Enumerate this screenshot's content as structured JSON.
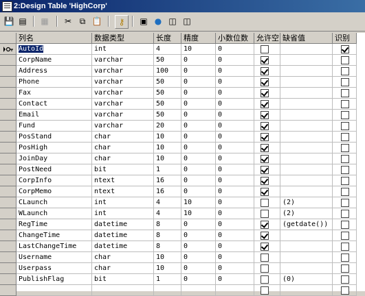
{
  "window": {
    "title": "2:Design Table 'HighCorp'"
  },
  "toolbar": {
    "icons": [
      "save-icon",
      "properties-icon",
      "generate-script-icon",
      "cut-icon",
      "copy-icon",
      "paste-icon",
      "primary-key-icon",
      "manage-indexes-icon",
      "manage-relationships-icon",
      "manage-constraints-icon",
      "manage-triggers-icon"
    ]
  },
  "columns": [
    "列名",
    "数据类型",
    "长度",
    "精度",
    "小数位数",
    "允许空",
    "缺省值",
    "识别"
  ],
  "rows": [
    {
      "name": "AutoId",
      "type": "int",
      "length": "4",
      "precision": "10",
      "scale": "0",
      "nullable": false,
      "default": "",
      "identity": true,
      "key": true
    },
    {
      "name": "CorpName",
      "type": "varchar",
      "length": "50",
      "precision": "0",
      "scale": "0",
      "nullable": true,
      "default": "",
      "identity": false
    },
    {
      "name": "Address",
      "type": "varchar",
      "length": "100",
      "precision": "0",
      "scale": "0",
      "nullable": true,
      "default": "",
      "identity": false
    },
    {
      "name": "Phone",
      "type": "varchar",
      "length": "50",
      "precision": "0",
      "scale": "0",
      "nullable": true,
      "default": "",
      "identity": false
    },
    {
      "name": "Fax",
      "type": "varchar",
      "length": "50",
      "precision": "0",
      "scale": "0",
      "nullable": true,
      "default": "",
      "identity": false
    },
    {
      "name": "Contact",
      "type": "varchar",
      "length": "50",
      "precision": "0",
      "scale": "0",
      "nullable": true,
      "default": "",
      "identity": false
    },
    {
      "name": "Email",
      "type": "varchar",
      "length": "50",
      "precision": "0",
      "scale": "0",
      "nullable": true,
      "default": "",
      "identity": false
    },
    {
      "name": "Fund",
      "type": "varchar",
      "length": "20",
      "precision": "0",
      "scale": "0",
      "nullable": true,
      "default": "",
      "identity": false
    },
    {
      "name": "PosStand",
      "type": "char",
      "length": "10",
      "precision": "0",
      "scale": "0",
      "nullable": true,
      "default": "",
      "identity": false
    },
    {
      "name": "PosHigh",
      "type": "char",
      "length": "10",
      "precision": "0",
      "scale": "0",
      "nullable": true,
      "default": "",
      "identity": false
    },
    {
      "name": "JoinDay",
      "type": "char",
      "length": "10",
      "precision": "0",
      "scale": "0",
      "nullable": true,
      "default": "",
      "identity": false
    },
    {
      "name": "PostNeed",
      "type": "bit",
      "length": "1",
      "precision": "0",
      "scale": "0",
      "nullable": true,
      "default": "",
      "identity": false
    },
    {
      "name": "CorpInfo",
      "type": "ntext",
      "length": "16",
      "precision": "0",
      "scale": "0",
      "nullable": true,
      "default": "",
      "identity": false
    },
    {
      "name": "CorpMemo",
      "type": "ntext",
      "length": "16",
      "precision": "0",
      "scale": "0",
      "nullable": true,
      "default": "",
      "identity": false
    },
    {
      "name": "CLaunch",
      "type": "int",
      "length": "4",
      "precision": "10",
      "scale": "0",
      "nullable": false,
      "default": "(2)",
      "identity": false
    },
    {
      "name": "WLaunch",
      "type": "int",
      "length": "4",
      "precision": "10",
      "scale": "0",
      "nullable": false,
      "default": "(2)",
      "identity": false
    },
    {
      "name": "RegTime",
      "type": "datetime",
      "length": "8",
      "precision": "0",
      "scale": "0",
      "nullable": true,
      "default": "(getdate())",
      "identity": false
    },
    {
      "name": "ChangeTime",
      "type": "datetime",
      "length": "8",
      "precision": "0",
      "scale": "0",
      "nullable": true,
      "default": "",
      "identity": false
    },
    {
      "name": "LastChangeTime",
      "type": "datetime",
      "length": "8",
      "precision": "0",
      "scale": "0",
      "nullable": true,
      "default": "",
      "identity": false
    },
    {
      "name": "Username",
      "type": "char",
      "length": "10",
      "precision": "0",
      "scale": "0",
      "nullable": false,
      "default": "",
      "identity": false
    },
    {
      "name": "Userpass",
      "type": "char",
      "length": "10",
      "precision": "0",
      "scale": "0",
      "nullable": false,
      "default": "",
      "identity": false
    },
    {
      "name": "PublishFlag",
      "type": "bit",
      "length": "1",
      "precision": "0",
      "scale": "0",
      "nullable": false,
      "default": "(0)",
      "identity": false
    }
  ],
  "blank_rows": 1,
  "colors": {
    "title_start": "#0a246a",
    "title_end": "#3a6ea5",
    "chrome": "#d4d0c8",
    "selection": "#0a246a"
  }
}
